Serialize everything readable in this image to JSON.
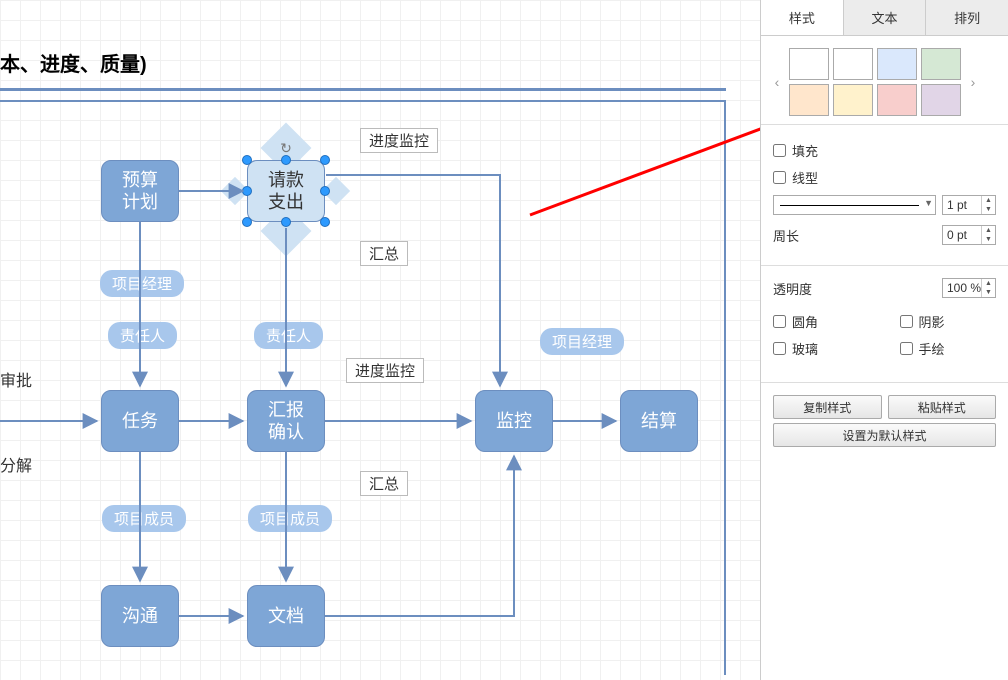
{
  "canvas": {
    "title": "本、进度、质量)",
    "nodes": {
      "budget": "预算\n计划",
      "payout": "请款\n支出",
      "task": "任务",
      "report": "汇报\n确认",
      "monitor": "监控",
      "settle": "结算",
      "comm": "沟通",
      "doc": "文档"
    },
    "pills": {
      "pm1": "项目经理",
      "owner1": "责任人",
      "owner2": "责任人",
      "member1": "项目成员",
      "member2": "项目成员",
      "pm2": "项目经理"
    },
    "tags": {
      "progress1": "进度监控",
      "summary1": "汇总",
      "progress2": "进度监控",
      "summary2": "汇总"
    },
    "side_labels": {
      "approve": "审批",
      "decompose": "分解"
    }
  },
  "sidebar": {
    "tabs": {
      "style": "样式",
      "text": "文本",
      "arrange": "排列"
    },
    "swatches": [
      "#ffffff",
      "#ffffff",
      "#dae8fc",
      "#d5e8d4",
      "#ffe6cc",
      "#fff2cc",
      "#f8cecc",
      "#e1d5e7"
    ],
    "fill": "填充",
    "stroke": "线型",
    "stroke_width": "1 pt",
    "perimeter_label": "周长",
    "perimeter_value": "0 pt",
    "opacity_label": "透明度",
    "opacity_value": "100 %",
    "rounded": "圆角",
    "shadow": "阴影",
    "glass": "玻璃",
    "sketch": "手绘",
    "copy_style": "复制样式",
    "paste_style": "粘贴样式",
    "set_default": "设置为默认样式"
  }
}
